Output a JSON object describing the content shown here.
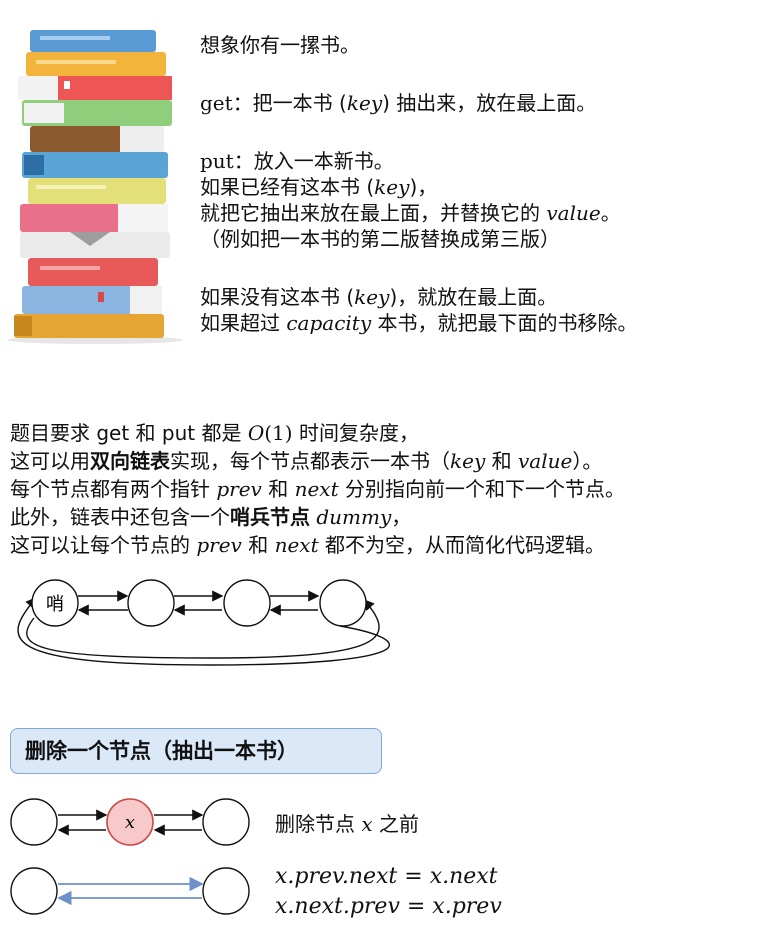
{
  "intro": {
    "l1": "想象你有一摞书。",
    "get_kw": "get",
    "get_a": "：把一本书 (",
    "get_key": "key",
    "get_b": ") 抽出来，放在最上面。",
    "put_kw": "put",
    "put_a": "：放入一本新书。",
    "l3a": "如果已经有这本书 (",
    "l3_key": "key",
    "l3b": ")，",
    "l4a": "就把它抽出来放在最上面，并替换它的 ",
    "l4_value": "value",
    "l4b": "。",
    "l5": "（例如把一本书的第二版替换成第三版）",
    "l6a": "如果没有这本书 (",
    "l6_key": "key",
    "l6b": ")，就放在最上面。",
    "l7a": "如果超过 ",
    "l7_cap": "capacity",
    "l7b": " 本书，就把最下面的书移除。"
  },
  "desc": {
    "l1a": "题目要求 get 和 put 都是 ",
    "l1_o": "O",
    "l1_one": "(1)",
    "l1b": " 时间复杂度，",
    "l2a": "这可以用",
    "l2_bold": "双向链表",
    "l2b": "实现，每个节点都表示一本书（",
    "l2_key": "key",
    "l2c": " 和 ",
    "l2_value": "value",
    "l2d": "）。",
    "l3a": "每个节点都有两个指针 ",
    "l3_prev": "prev",
    "l3b": " 和 ",
    "l3_next": "next",
    "l3c": " 分别指向前一个和下一个节点。",
    "l4a": "此外，链表中还包含一个",
    "l4_bold": "哨兵节点",
    "l4_dummy": "dummy",
    "l4b": "，",
    "l5a": "这可以让每个节点的 ",
    "l5_prev": "prev",
    "l5b": " 和 ",
    "l5_next": "next",
    "l5c": " 都不为空，从而简化代码逻辑。"
  },
  "diagram": {
    "sentinel_label": "哨",
    "node_x_label": "x",
    "section_title": "删除一个节点（抽出一本书）",
    "before_label_a": "删除节点 ",
    "before_label_x": "x",
    "before_label_b": " 之前",
    "formula_1": "x.prev.next = x.next",
    "formula_2": "x.next.prev = x.prev"
  },
  "colors": {
    "highlight_node_fill": "#f7c9c9",
    "highlight_node_stroke": "#c94a4a",
    "section_fill": "#dbe8f8",
    "section_border": "#7fa6d8",
    "new_link": "#6d90c9"
  }
}
